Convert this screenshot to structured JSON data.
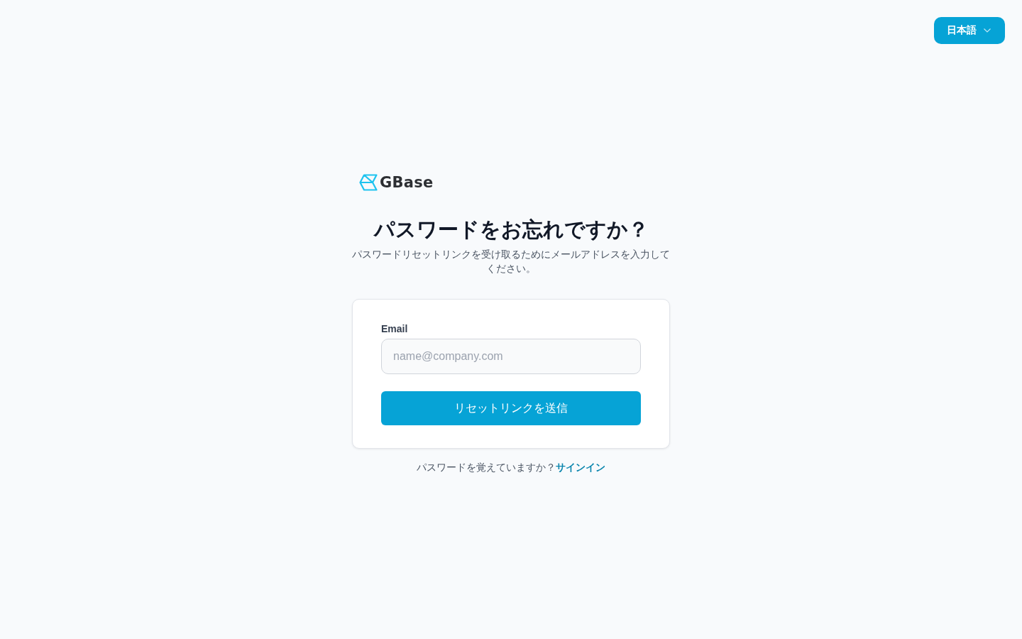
{
  "language_button": {
    "label": "日本語"
  },
  "logo": {
    "text": "GBase"
  },
  "heading": "パスワードをお忘れですか？",
  "subheading": "パスワードリセットリンクを受け取るためにメールアドレスを入力してください。",
  "form": {
    "email": {
      "label": "Email",
      "placeholder": "name@company.com"
    },
    "submit_button": "リセットリンクを送信"
  },
  "footer": {
    "text": "パスワードを覚えていますか？",
    "link": "サインイン"
  }
}
